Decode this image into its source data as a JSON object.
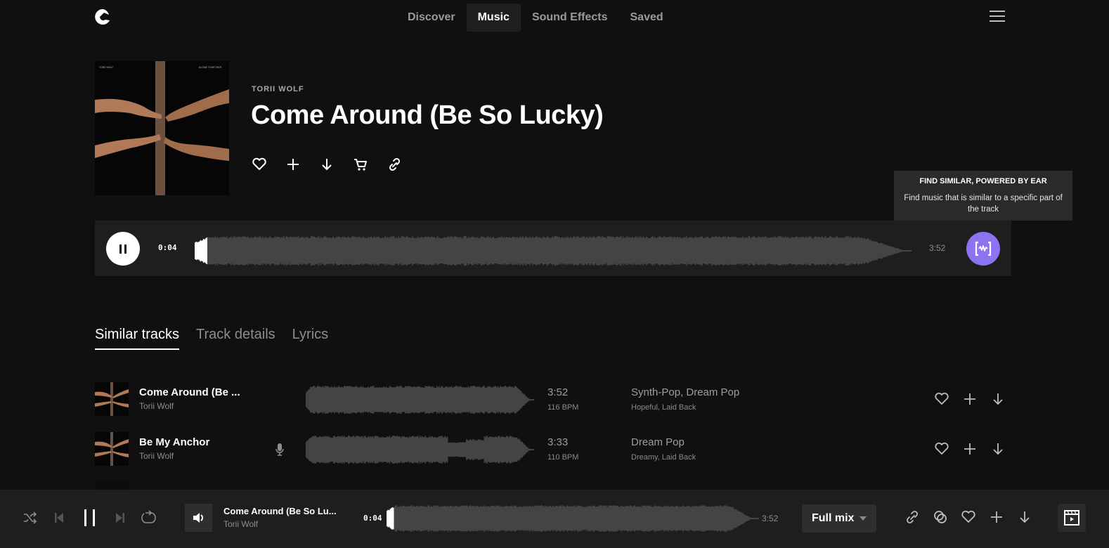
{
  "nav": {
    "logo": "epidemic-logo-icon",
    "tabs": [
      {
        "label": "Discover",
        "active": false
      },
      {
        "label": "Music",
        "active": true
      },
      {
        "label": "Sound Effects",
        "active": false
      },
      {
        "label": "Saved",
        "active": false
      }
    ],
    "menu_icon": "hamburger-icon"
  },
  "hero": {
    "artist": "TORII WOLF",
    "title": "Come Around (Be So Lucky)",
    "cover_top_left": "TORII WOLF",
    "cover_top_right": "ALONE TOGETHER",
    "actions": [
      "heart-icon",
      "plus-icon",
      "download-icon",
      "cart-icon",
      "link-icon"
    ]
  },
  "player": {
    "state": "playing",
    "current_time": "0:04",
    "duration": "3:52",
    "progress_fraction": 0.017,
    "find_similar_icon": "ear-waveform-icon"
  },
  "tooltip": {
    "title": "FIND SIMILAR, POWERED BY EAR",
    "body": "Find music that is similar to a specific part of the track"
  },
  "subtabs": [
    {
      "label": "Similar tracks",
      "active": true
    },
    {
      "label": "Track details",
      "active": false
    },
    {
      "label": "Lyrics",
      "active": false
    }
  ],
  "tracks": [
    {
      "title": "Come Around (Be ...",
      "artist": "Torii Wolf",
      "vocals": false,
      "duration": "3:52",
      "bpm": "116 BPM",
      "genres": "Synth-Pop, Dream Pop",
      "moods": "Hopeful, Laid Back"
    },
    {
      "title": "Be My Anchor",
      "artist": "Torii Wolf",
      "vocals": true,
      "duration": "3:33",
      "bpm": "110 BPM",
      "genres": "Dream Pop",
      "moods": "Dreamy, Laid Back"
    }
  ],
  "bottom_bar": {
    "now_playing_title": "Come Around (Be So Lu...",
    "now_playing_artist": "Torii Wolf",
    "current_time": "0:04",
    "duration": "3:52",
    "progress_fraction": 0.017,
    "mix_label": "Full mix",
    "controls": [
      "shuffle-icon",
      "previous-icon",
      "pause-icon",
      "next-icon",
      "repeat-icon"
    ],
    "actions": [
      "link-icon",
      "similar-icon",
      "heart-icon",
      "plus-icon",
      "download-icon"
    ]
  },
  "colors": {
    "background": "#101010",
    "panel": "#1e1e1e",
    "accent": "#8c73f2",
    "waveform": "#444444",
    "waveform_played": "#ffffff"
  }
}
